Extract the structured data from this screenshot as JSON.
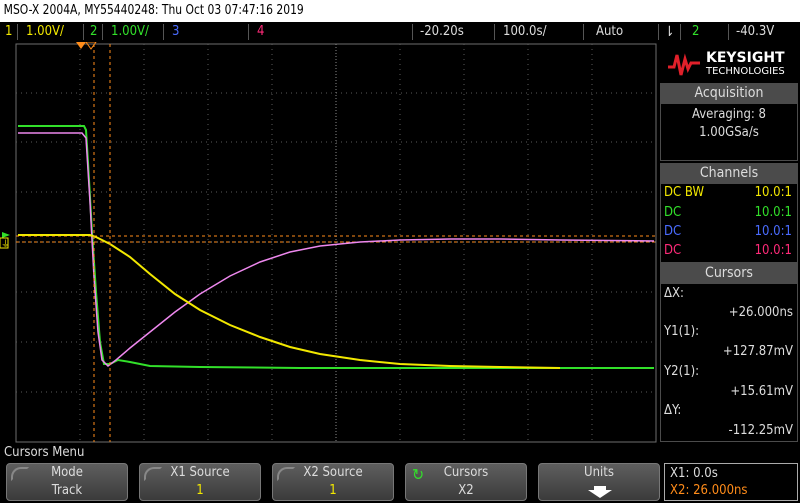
{
  "title": "MSO-X 2004A, MY55440248: Thu Oct 03 07:47:16 2019",
  "channel_bar": {
    "ch1_num": "1",
    "ch1_scale": "1.00V/",
    "ch2_num": "2",
    "ch2_scale": "1.00V/",
    "ch3_num": "3",
    "ch4_num": "4",
    "time_offset": "-20.20s",
    "time_scale": "100.0s/",
    "mode": "Auto",
    "trigger_icon": "trigger-edge-icon",
    "trigger_source": "2",
    "trigger_level": "-40.3V"
  },
  "brand": {
    "name": "KEYSIGHT",
    "sub": "TECHNOLOGIES"
  },
  "acquisition": {
    "title": "Acquisition",
    "averaging": "Averaging: 8",
    "rate": "1.00GSa/s"
  },
  "channels": {
    "title": "Channels",
    "rows": [
      {
        "coupling": "DC BW",
        "probe": "10.0:1",
        "color": "#f2e800"
      },
      {
        "coupling": "DC",
        "probe": "10.0:1",
        "color": "#32e02a"
      },
      {
        "coupling": "DC",
        "probe": "10.0:1",
        "color": "#4a6cff"
      },
      {
        "coupling": "DC",
        "probe": "10.0:1",
        "color": "#ff2a78"
      }
    ]
  },
  "cursors_panel": {
    "title": "Cursors",
    "dx_label": "ΔX:",
    "dx_value": "+26.000ns",
    "y1_label": "Y1(1):",
    "y1_value": "+127.87mV",
    "y2_label": "Y2(1):",
    "y2_value": "+15.61mV",
    "dy_label": "ΔY:",
    "dy_value": "-112.25mV"
  },
  "menu": {
    "title": "Cursors Menu",
    "softkeys": [
      {
        "line1": "Mode",
        "line2": "Track"
      },
      {
        "line1": "X1 Source",
        "line2": "1"
      },
      {
        "line1": "X2 Source",
        "line2": "1"
      },
      {
        "line1": "Cursors",
        "line2": "X2"
      },
      {
        "line1": "Units",
        "line2": ""
      }
    ]
  },
  "cursor_readout": {
    "x1": "X1: 0.0s",
    "x2": "X2: 26.000ns"
  },
  "colors": {
    "ch1": "#f2e800",
    "ch2": "#32e02a",
    "math": "#ee88ee",
    "cursor": "#ff8c1a"
  }
}
